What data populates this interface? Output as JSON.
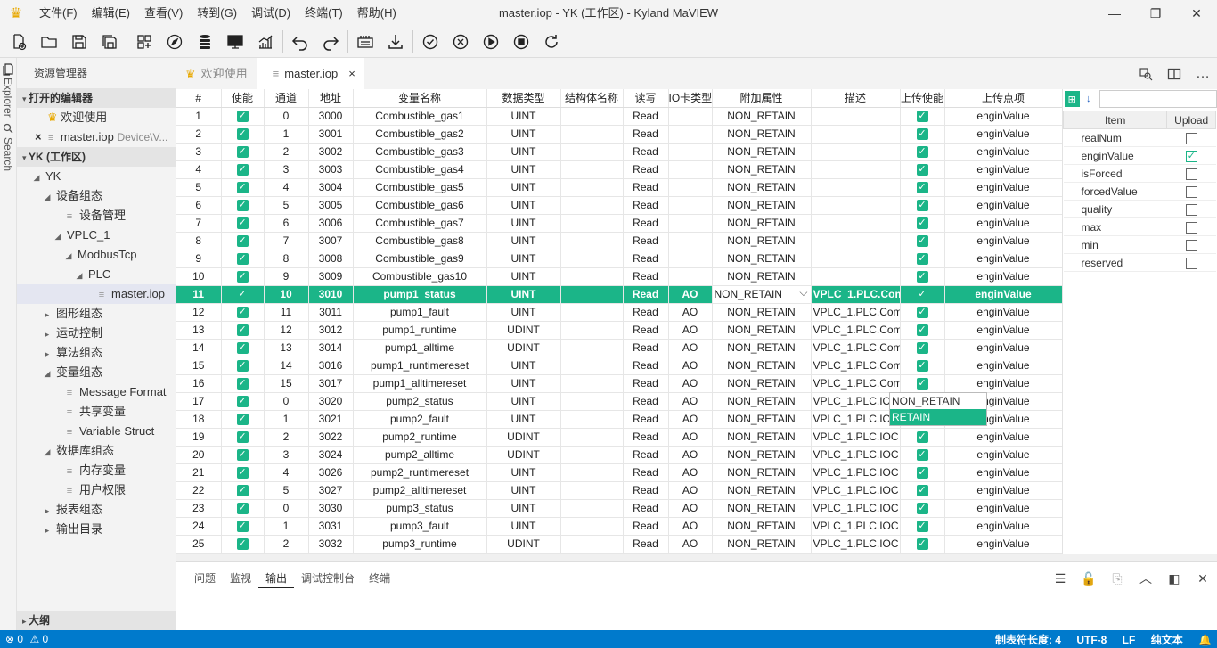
{
  "window": {
    "title": "master.iop - YK (工作区) - Kyland MaVIEW",
    "menu": [
      "文件(F)",
      "编辑(E)",
      "查看(V)",
      "转到(G)",
      "调试(D)",
      "终端(T)",
      "帮助(H)"
    ]
  },
  "activity": {
    "explorer": "Explorer",
    "search": "Search"
  },
  "sidebar": {
    "header": "资源管理器",
    "open_editors_title": "打开的编辑器",
    "open_editors": [
      {
        "label": "欢迎使用",
        "hint": ""
      },
      {
        "label": "master.iop",
        "hint": "Device\\V..."
      }
    ],
    "workspace_title": "YK (工作区)",
    "tree": [
      {
        "label": "YK",
        "level": 1,
        "twisty": "open"
      },
      {
        "label": "设备组态",
        "level": 2,
        "twisty": "open"
      },
      {
        "label": "设备管理",
        "level": 3,
        "twisty": "none",
        "file": true
      },
      {
        "label": "VPLC_1",
        "level": 3,
        "twisty": "open"
      },
      {
        "label": "ModbusTcp",
        "level": 4,
        "twisty": "open"
      },
      {
        "label": "PLC",
        "level": 5,
        "twisty": "open"
      },
      {
        "label": "master.iop",
        "level": 6,
        "twisty": "none",
        "file": true,
        "selected": true
      },
      {
        "label": "图形组态",
        "level": 2,
        "twisty": "closed"
      },
      {
        "label": "运动控制",
        "level": 2,
        "twisty": "closed"
      },
      {
        "label": "算法组态",
        "level": 2,
        "twisty": "closed"
      },
      {
        "label": "变量组态",
        "level": 2,
        "twisty": "open"
      },
      {
        "label": "Message Format",
        "level": 3,
        "twisty": "none",
        "file": true
      },
      {
        "label": "共享变量",
        "level": 3,
        "twisty": "none",
        "file": true
      },
      {
        "label": "Variable Struct",
        "level": 3,
        "twisty": "none",
        "file": true
      },
      {
        "label": "数据库组态",
        "level": 2,
        "twisty": "open"
      },
      {
        "label": "内存变量",
        "level": 3,
        "twisty": "none",
        "file": true
      },
      {
        "label": "用户权限",
        "level": 3,
        "twisty": "none",
        "file": true
      },
      {
        "label": "报表组态",
        "level": 2,
        "twisty": "closed"
      },
      {
        "label": "输出目录",
        "level": 2,
        "twisty": "closed"
      }
    ],
    "outline": "大纲"
  },
  "tabs": [
    {
      "label": "欢迎使用",
      "active": false
    },
    {
      "label": "master.iop",
      "active": true,
      "close": "×"
    }
  ],
  "table": {
    "columns": [
      "#",
      "使能",
      "通道",
      "地址",
      "变量名称",
      "数据类型",
      "结构体名称",
      "读写",
      "IO卡类型",
      "附加属性",
      "描述",
      "上传使能",
      "上传点项"
    ],
    "rows": [
      [
        "1",
        "0",
        "3000",
        "Combustible_gas1",
        "UINT",
        "",
        "Read",
        "",
        "NON_RETAIN",
        "",
        "enginValue"
      ],
      [
        "2",
        "1",
        "3001",
        "Combustible_gas2",
        "UINT",
        "",
        "Read",
        "",
        "NON_RETAIN",
        "",
        "enginValue"
      ],
      [
        "3",
        "2",
        "3002",
        "Combustible_gas3",
        "UINT",
        "",
        "Read",
        "",
        "NON_RETAIN",
        "",
        "enginValue"
      ],
      [
        "4",
        "3",
        "3003",
        "Combustible_gas4",
        "UINT",
        "",
        "Read",
        "",
        "NON_RETAIN",
        "",
        "enginValue"
      ],
      [
        "5",
        "4",
        "3004",
        "Combustible_gas5",
        "UINT",
        "",
        "Read",
        "",
        "NON_RETAIN",
        "",
        "enginValue"
      ],
      [
        "6",
        "5",
        "3005",
        "Combustible_gas6",
        "UINT",
        "",
        "Read",
        "",
        "NON_RETAIN",
        "",
        "enginValue"
      ],
      [
        "7",
        "6",
        "3006",
        "Combustible_gas7",
        "UINT",
        "",
        "Read",
        "",
        "NON_RETAIN",
        "",
        "enginValue"
      ],
      [
        "8",
        "7",
        "3007",
        "Combustible_gas8",
        "UINT",
        "",
        "Read",
        "",
        "NON_RETAIN",
        "",
        "enginValue"
      ],
      [
        "9",
        "8",
        "3008",
        "Combustible_gas9",
        "UINT",
        "",
        "Read",
        "",
        "NON_RETAIN",
        "",
        "enginValue"
      ],
      [
        "10",
        "9",
        "3009",
        "Combustible_gas10",
        "UINT",
        "",
        "Read",
        "",
        "NON_RETAIN",
        "",
        "enginValue"
      ],
      [
        "11",
        "10",
        "3010",
        "pump1_status",
        "UINT",
        "",
        "Read",
        "AO",
        "NON_RETAIN",
        "VPLC_1.PLC.Com",
        "enginValue"
      ],
      [
        "12",
        "11",
        "3011",
        "pump1_fault",
        "UINT",
        "",
        "Read",
        "AO",
        "NON_RETAIN",
        "VPLC_1.PLC.Com",
        "enginValue"
      ],
      [
        "13",
        "12",
        "3012",
        "pump1_runtime",
        "UDINT",
        "",
        "Read",
        "AO",
        "NON_RETAIN",
        "VPLC_1.PLC.Com",
        "enginValue"
      ],
      [
        "14",
        "13",
        "3014",
        "pump1_alltime",
        "UDINT",
        "",
        "Read",
        "AO",
        "NON_RETAIN",
        "VPLC_1.PLC.Com",
        "enginValue"
      ],
      [
        "15",
        "14",
        "3016",
        "pump1_runtimereset",
        "UINT",
        "",
        "Read",
        "AO",
        "NON_RETAIN",
        "VPLC_1.PLC.Com",
        "enginValue"
      ],
      [
        "16",
        "15",
        "3017",
        "pump1_alltimereset",
        "UINT",
        "",
        "Read",
        "AO",
        "NON_RETAIN",
        "VPLC_1.PLC.Com",
        "enginValue"
      ],
      [
        "17",
        "0",
        "3020",
        "pump2_status",
        "UINT",
        "",
        "Read",
        "AO",
        "NON_RETAIN",
        "VPLC_1.PLC.IOC",
        "enginValue"
      ],
      [
        "18",
        "1",
        "3021",
        "pump2_fault",
        "UINT",
        "",
        "Read",
        "AO",
        "NON_RETAIN",
        "VPLC_1.PLC.IOC",
        "enginValue"
      ],
      [
        "19",
        "2",
        "3022",
        "pump2_runtime",
        "UDINT",
        "",
        "Read",
        "AO",
        "NON_RETAIN",
        "VPLC_1.PLC.IOC",
        "enginValue"
      ],
      [
        "20",
        "3",
        "3024",
        "pump2_alltime",
        "UDINT",
        "",
        "Read",
        "AO",
        "NON_RETAIN",
        "VPLC_1.PLC.IOC",
        "enginValue"
      ],
      [
        "21",
        "4",
        "3026",
        "pump2_runtimereset",
        "UINT",
        "",
        "Read",
        "AO",
        "NON_RETAIN",
        "VPLC_1.PLC.IOC",
        "enginValue"
      ],
      [
        "22",
        "5",
        "3027",
        "pump2_alltimereset",
        "UINT",
        "",
        "Read",
        "AO",
        "NON_RETAIN",
        "VPLC_1.PLC.IOC",
        "enginValue"
      ],
      [
        "23",
        "0",
        "3030",
        "pump3_status",
        "UINT",
        "",
        "Read",
        "AO",
        "NON_RETAIN",
        "VPLC_1.PLC.IOC",
        "enginValue"
      ],
      [
        "24",
        "1",
        "3031",
        "pump3_fault",
        "UINT",
        "",
        "Read",
        "AO",
        "NON_RETAIN",
        "VPLC_1.PLC.IOC",
        "enginValue"
      ],
      [
        "25",
        "2",
        "3032",
        "pump3_runtime",
        "UDINT",
        "",
        "Read",
        "AO",
        "NON_RETAIN",
        "VPLC_1.PLC.IOC",
        "enginValue"
      ]
    ],
    "selected_row": "11",
    "check_mark": "✓",
    "dropdown_options": [
      "NON_RETAIN",
      "RETAIN"
    ],
    "dropdown_highlight": "RETAIN",
    "accent": "#1bb588"
  },
  "props": {
    "headers": [
      "Item",
      "Upload"
    ],
    "items": [
      {
        "name": "realNum",
        "checked": false
      },
      {
        "name": "enginValue",
        "checked": true
      },
      {
        "name": "isForced",
        "checked": false
      },
      {
        "name": "forcedValue",
        "checked": false
      },
      {
        "name": "quality",
        "checked": false
      },
      {
        "name": "max",
        "checked": false
      },
      {
        "name": "min",
        "checked": false
      },
      {
        "name": "reserved",
        "checked": false
      }
    ]
  },
  "panel": {
    "tabs": [
      "问题",
      "监视",
      "输出",
      "调试控制台",
      "终端"
    ],
    "active": "输出"
  },
  "status": {
    "errors": "0",
    "warnings": "0",
    "tab_size": "制表符长度: 4",
    "encoding": "UTF-8",
    "eol": "LF",
    "mode": "纯文本"
  }
}
